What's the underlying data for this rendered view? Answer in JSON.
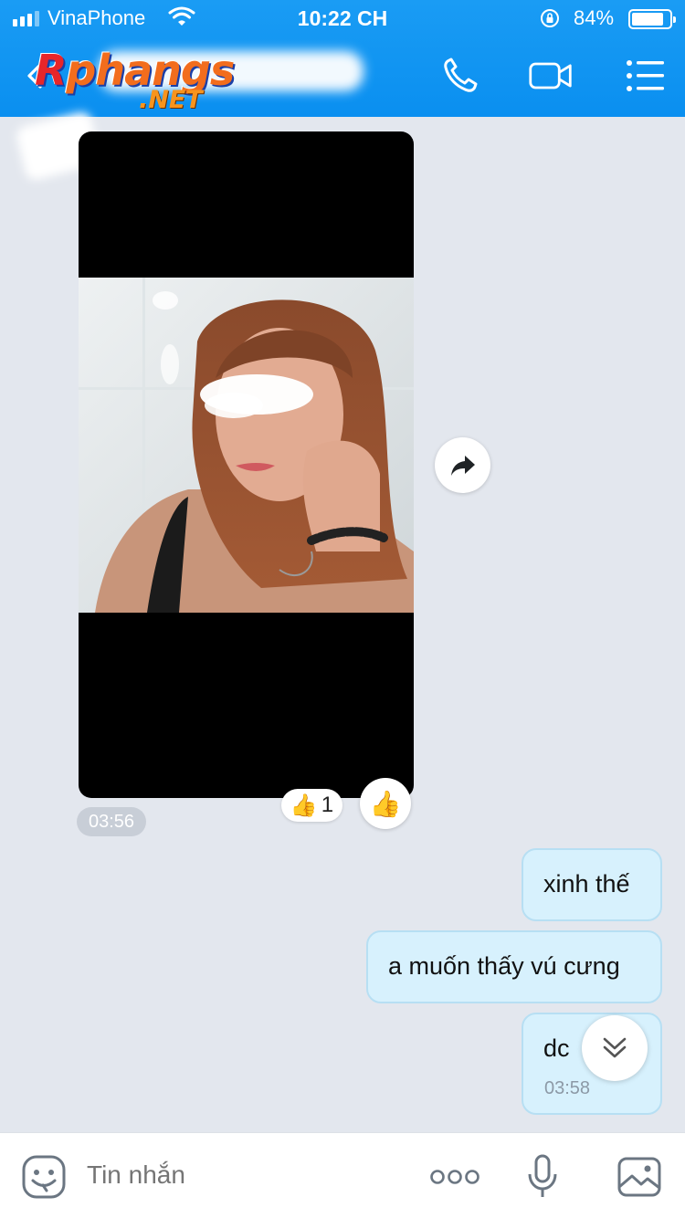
{
  "status_bar": {
    "carrier": "VinaPhone",
    "time": "10:22 CH",
    "battery_percent_label": "84%",
    "battery_level": 0.84
  },
  "header": {
    "watermark_logo": "Rphangs",
    "watermark_net": ".NET",
    "icons": [
      "back-chevron-icon",
      "phone-icon",
      "video-camera-icon",
      "menu-list-icon"
    ],
    "accent_color": "#0a8ff0"
  },
  "chat": {
    "image_message": {
      "time": "03:56",
      "reaction_emoji": "👍",
      "reaction_count": "1"
    },
    "messages": [
      {
        "text": "xinh thế"
      },
      {
        "text": "a muốn thấy vú cưng"
      },
      {
        "text": "dc",
        "time": "03:58"
      }
    ],
    "bubble_color": "#d7f1fd"
  },
  "composer": {
    "placeholder": "Tin nhắn",
    "icons": [
      "sticker-face-icon",
      "more-dots-icon",
      "microphone-icon",
      "gallery-icon"
    ]
  }
}
